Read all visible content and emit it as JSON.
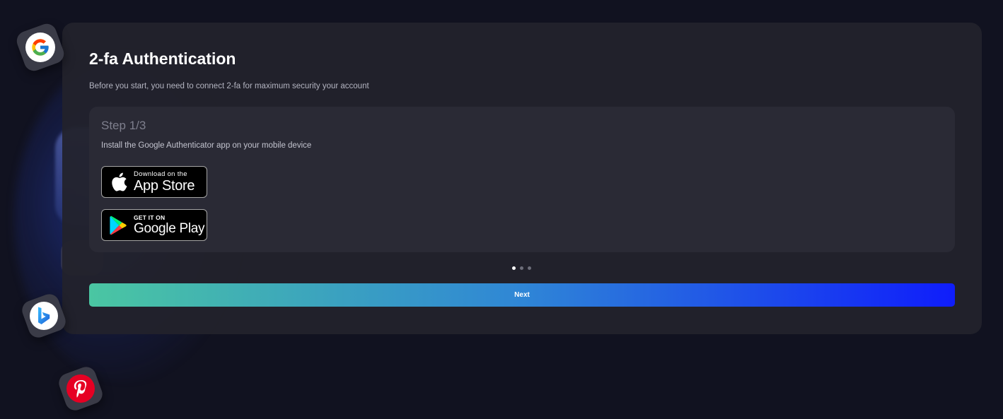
{
  "header": {
    "title": "2-fa Authentication",
    "subtitle": "Before you start, you need to connect 2-fa for maximum security your account"
  },
  "step": {
    "label": "Step 1/3",
    "description": "Install the Google Authenticator app on your mobile device"
  },
  "app_store": {
    "small_text": "Download on the",
    "big_text": "App Store",
    "icon": "apple-icon"
  },
  "google_play": {
    "small_text": "GET IT ON",
    "big_text": "Google Play",
    "icon": "google-play-icon"
  },
  "pagination": {
    "total": 3,
    "current": 1
  },
  "actions": {
    "next_label": "Next"
  },
  "floating_icons": [
    "google-icon",
    "bing-icon",
    "pinterest-icon"
  ],
  "colors": {
    "background": "#111220",
    "card": "#22222c",
    "panel": "#2a2a35",
    "next_gradient_start": "#4ac6a2",
    "next_gradient_end": "#0f1dfb"
  }
}
